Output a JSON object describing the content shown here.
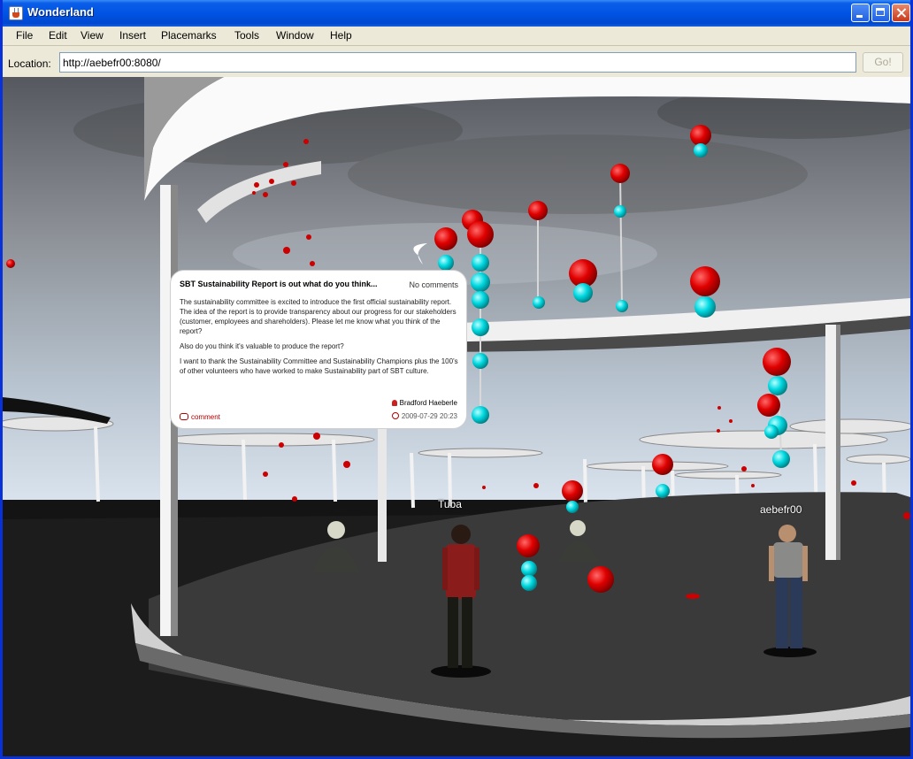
{
  "window": {
    "title": "Wonderland"
  },
  "menu": [
    "File",
    "Edit",
    "View",
    "Insert",
    "Placemarks",
    "Tools",
    "Window",
    "Help"
  ],
  "location": {
    "label": "Location:",
    "value": "http://aebefr00:8080/",
    "go_label": "Go!"
  },
  "post": {
    "title": "SBT Sustainability Report is out what do you think...",
    "comments_count": "No comments",
    "paragraphs": [
      "The sustainability committee is excited to introduce the first official sustainability report.  The idea of the report is to provide transparency about our progress for our stakeholders (customer, employees and shareholders).  Please let me know what you think of the report?",
      " Also do you think it's valuable to produce the report?",
      "I want to thank the Sustainability Committee and Sustainability Champions plus the 100's of other volunteers who have worked to make Sustainability part of SBT culture."
    ],
    "author": "Bradford Haeberle",
    "comment_link": "comment",
    "date": "2009-07-29 20:23"
  },
  "avatars": [
    {
      "name": "Tuba"
    },
    {
      "name": "aebefr00"
    }
  ],
  "colors": {
    "title_bar": "#0054e3",
    "balloon_red": "#e00000",
    "balloon_cyan": "#00d8e0"
  },
  "icons": [
    "java-app-icon",
    "minimize-icon",
    "maximize-icon",
    "close-icon",
    "user-icon",
    "comment-icon",
    "clock-icon"
  ]
}
